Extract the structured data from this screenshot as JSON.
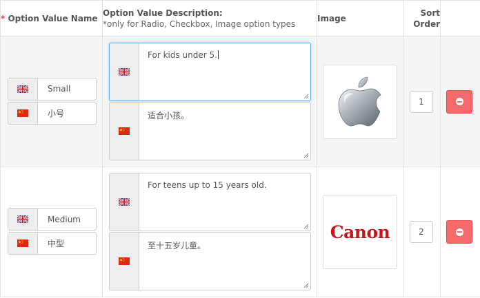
{
  "headers": {
    "required_mark": "*",
    "option_value_name": "Option Value Name",
    "option_value_description": "Option Value Description:",
    "description_note": "*only for Radio, Checkbox, Image option types",
    "image": "Image",
    "sort_order_line1": "Sort",
    "sort_order_line2": "Order"
  },
  "rows": [
    {
      "name_en": "Small",
      "name_zh": "小号",
      "desc_en": "For kids under 5.",
      "desc_zh": "适合小孩。",
      "image": "apple-logo",
      "sort_order": "1"
    },
    {
      "name_en": "Medium",
      "name_zh": "中型",
      "desc_en": "For teens up to 15 years old.",
      "desc_zh": "至十五岁儿童。",
      "image_text": "Canon",
      "sort_order": "2"
    }
  ],
  "icons": {
    "lang_en": "uk-flag-icon",
    "lang_zh": "china-flag-icon",
    "remove": "minus-circle-icon"
  },
  "colors": {
    "required": "#e04a45",
    "remove_button": "#f56b6b",
    "canon_red": "#c4161c",
    "focus_border": "#66afe9"
  }
}
